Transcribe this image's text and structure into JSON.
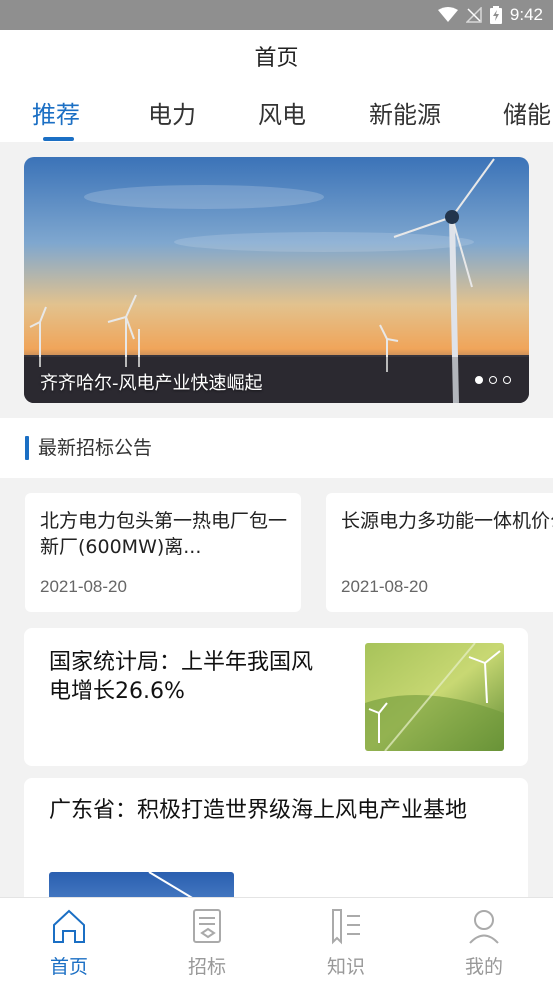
{
  "status_bar": {
    "time": "9:42",
    "icons": [
      "wifi-icon",
      "no-signal-icon",
      "battery-charging-icon"
    ]
  },
  "header": {
    "title": "首页"
  },
  "tabs": [
    {
      "label": "推荐",
      "active": true
    },
    {
      "label": "电力",
      "active": false
    },
    {
      "label": "风电",
      "active": false
    },
    {
      "label": "新能源",
      "active": false
    },
    {
      "label": "储能",
      "active": false
    }
  ],
  "banner": {
    "caption": "齐齐哈尔-风电产业快速崛起",
    "slide_count": 3,
    "current_slide": 1
  },
  "tender_section": {
    "title": "最新招标公告",
    "items": [
      {
        "title": "北方电力包头第一热电厂包一新厂(600MW)离...",
        "date": "2021-08-20"
      },
      {
        "title": "长源电力多功能一体机价公告",
        "date": "2021-08-20"
      }
    ]
  },
  "news": [
    {
      "title": "国家统计局：上半年我国风电增长26.6%",
      "thumb": "wind-farm-field-image"
    },
    {
      "title": "广东省：积极打造世界级海上风电产业基地",
      "thumb": "wind-turbine-sky-image"
    }
  ],
  "bottom_nav": [
    {
      "label": "首页",
      "icon": "home-icon",
      "active": true
    },
    {
      "label": "招标",
      "icon": "document-icon",
      "active": false
    },
    {
      "label": "知识",
      "icon": "book-icon",
      "active": false
    },
    {
      "label": "我的",
      "icon": "user-icon",
      "active": false
    }
  ],
  "colors": {
    "accent": "#1b6fc4",
    "status_bar": "#8f8f8f",
    "background": "#f2f2f2"
  }
}
